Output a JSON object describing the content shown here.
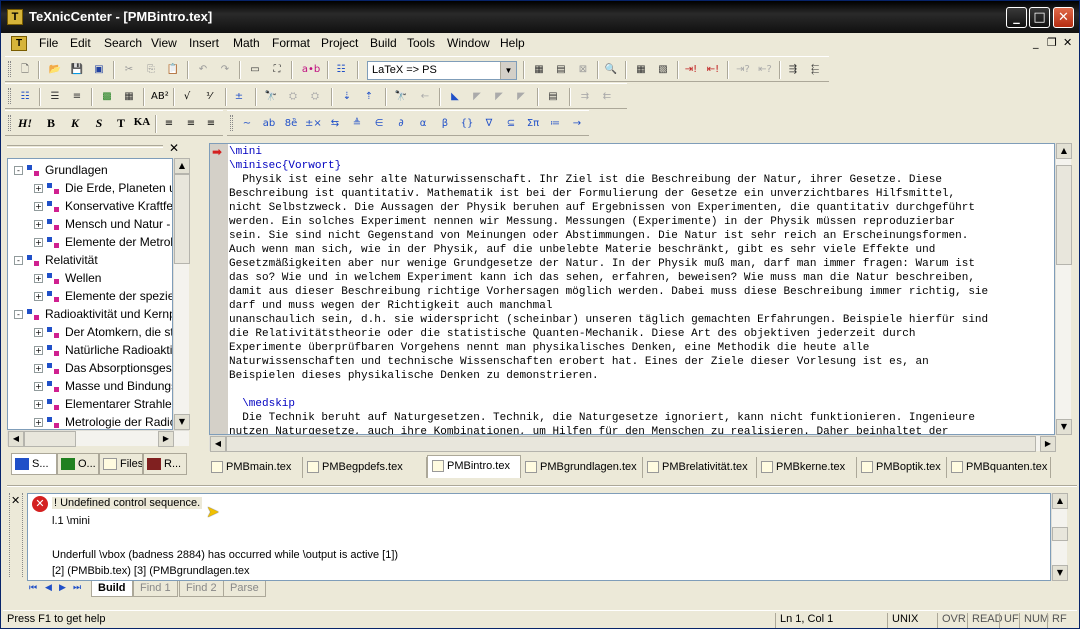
{
  "window": {
    "title": "TeXnicCenter - [PMBintro.tex]",
    "app_icon": "T"
  },
  "menu": [
    "File",
    "Edit",
    "Search",
    "View",
    "Insert",
    "Math",
    "Format",
    "Project",
    "Build",
    "Tools",
    "Window",
    "Help"
  ],
  "toolbar": {
    "output_profile": "LaTeX => PS",
    "style_buttons": [
      "H!",
      "B",
      "K",
      "S",
      "T",
      "KA"
    ]
  },
  "navigator": {
    "tree": [
      {
        "label": "Grundlagen",
        "level": 0,
        "expander": "-"
      },
      {
        "label": "Die Erde, Planeten u",
        "level": 1,
        "expander": "+"
      },
      {
        "label": "Konservative Kraftfe",
        "level": 1,
        "expander": "+"
      },
      {
        "label": "Mensch und Natur -",
        "level": 1,
        "expander": "+"
      },
      {
        "label": "Elemente der Metrol",
        "level": 1,
        "expander": "+"
      },
      {
        "label": "Relativität",
        "level": 0,
        "expander": "-"
      },
      {
        "label": "Wellen",
        "level": 1,
        "expander": "+"
      },
      {
        "label": "Elemente der spezie",
        "level": 1,
        "expander": "+"
      },
      {
        "label": "Radioaktivität und Kernp",
        "level": 0,
        "expander": "-"
      },
      {
        "label": "Der Atomkern, die st",
        "level": 1,
        "expander": "+"
      },
      {
        "label": "Natürliche Radioakti",
        "level": 1,
        "expander": "+"
      },
      {
        "label": "Das Absorptionsges",
        "level": 1,
        "expander": "+"
      },
      {
        "label": "Masse und Bindungs",
        "level": 1,
        "expander": "+"
      },
      {
        "label": "Elementarer Strahler",
        "level": 1,
        "expander": "+"
      },
      {
        "label": "Metrologie der Radic",
        "level": 1,
        "expander": "+"
      }
    ],
    "tabs": [
      "S...",
      "O...",
      "Files",
      "R..."
    ]
  },
  "editor": {
    "lines": [
      "\\mini",
      "\\minisec{Vorwort}",
      "  Physik ist eine sehr alte Naturwissenschaft. Ihr Ziel ist die Beschreibung der Natur, ihrer Gesetze. Diese",
      "Beschreibung ist quantitativ. Mathematik ist bei der Formulierung der Gesetze ein unverzichtbares Hilfsmittel,",
      "nicht Selbstzweck. Die Aussagen der Physik beruhen auf Ergebnissen von Experimenten, die quantitativ durchgeführt",
      "werden. Ein solches Experiment nennen wir Messung. Messungen (Experimente) in der Physik müssen reproduzierbar",
      "sein. Sie sind nicht Gegenstand von Meinungen oder Abstimmungen. Die Natur ist sehr reich an Erscheinungsformen.",
      "Auch wenn man sich, wie in der Physik, auf die unbelebte Materie beschränkt, gibt es sehr viele Effekte und",
      "Gesetzmäßigkeiten aber nur wenige Grundgesetze der Natur. In der Physik muß man, darf man immer fragen: Warum ist",
      "das so? Wie und in welchem Experiment kann ich das sehen, erfahren, beweisen? Wie muss man die Natur beschreiben,",
      "damit aus dieser Beschreibung richtige Vorhersagen möglich werden. Dabei muss diese Beschreibung immer richtig, sie",
      "darf und muss wegen der Richtigkeit auch manchmal",
      "unanschaulich sein, d.h. sie widerspricht (scheinbar) unseren täglich gemachten Erfahrungen. Beispiele hierfür sind",
      "die Relativitätstheorie oder die statistische Quanten-Mechanik. Diese Art des objektiven jederzeit durch",
      "Experimente überprüfbaren Vorgehens nennt man physikalisches Denken, eine Methodik die heute alle",
      "Naturwissenschaften und technische Wissenschaften erobert hat. Eines der Ziele dieser Vorlesung ist es, an",
      "Beispielen dieses physikalische Denken zu demonstrieren.",
      "",
      "  \\medskip",
      "  Die Technik beruht auf Naturgesetzen. Technik, die Naturgesetze ignoriert, kann nicht funktionieren. Ingenieure",
      "nutzen Naturgesetze, auch ihre Kombinationen, um Hilfen für den Menschen zu realisieren. Daher beinhaltet der"
    ]
  },
  "file_tabs": [
    "PMBmain.tex",
    "PMBegpdefs.tex",
    "PMBintro.tex",
    "PMBgrundlagen.tex",
    "PMBrelativität.tex",
    "PMBkerne.tex",
    "PMBoptik.tex",
    "PMBquanten.tex"
  ],
  "active_file_tab": "PMBintro.tex",
  "output": {
    "lines": [
      "! Undefined control sequence.",
      "l.1 \\mini",
      "",
      "Underfull \\vbox (badness 2884) has occurred while \\output is active [1])",
      "[2] (PMBbib.tex) [3] (PMBgrundlagen.tex"
    ],
    "tabs": [
      "Build",
      "Find 1",
      "Find 2",
      "Parse"
    ]
  },
  "status": {
    "help": "Press F1 to get help",
    "position": "Ln 1, Col 1",
    "line_ending": "UNIX",
    "indicators": [
      "OVR",
      "READ",
      "UF",
      "NUM",
      "RF"
    ]
  },
  "colors": {
    "error_icon": "#d42020",
    "editor_keyword": "#0000c0",
    "titlebar": "#000000"
  }
}
